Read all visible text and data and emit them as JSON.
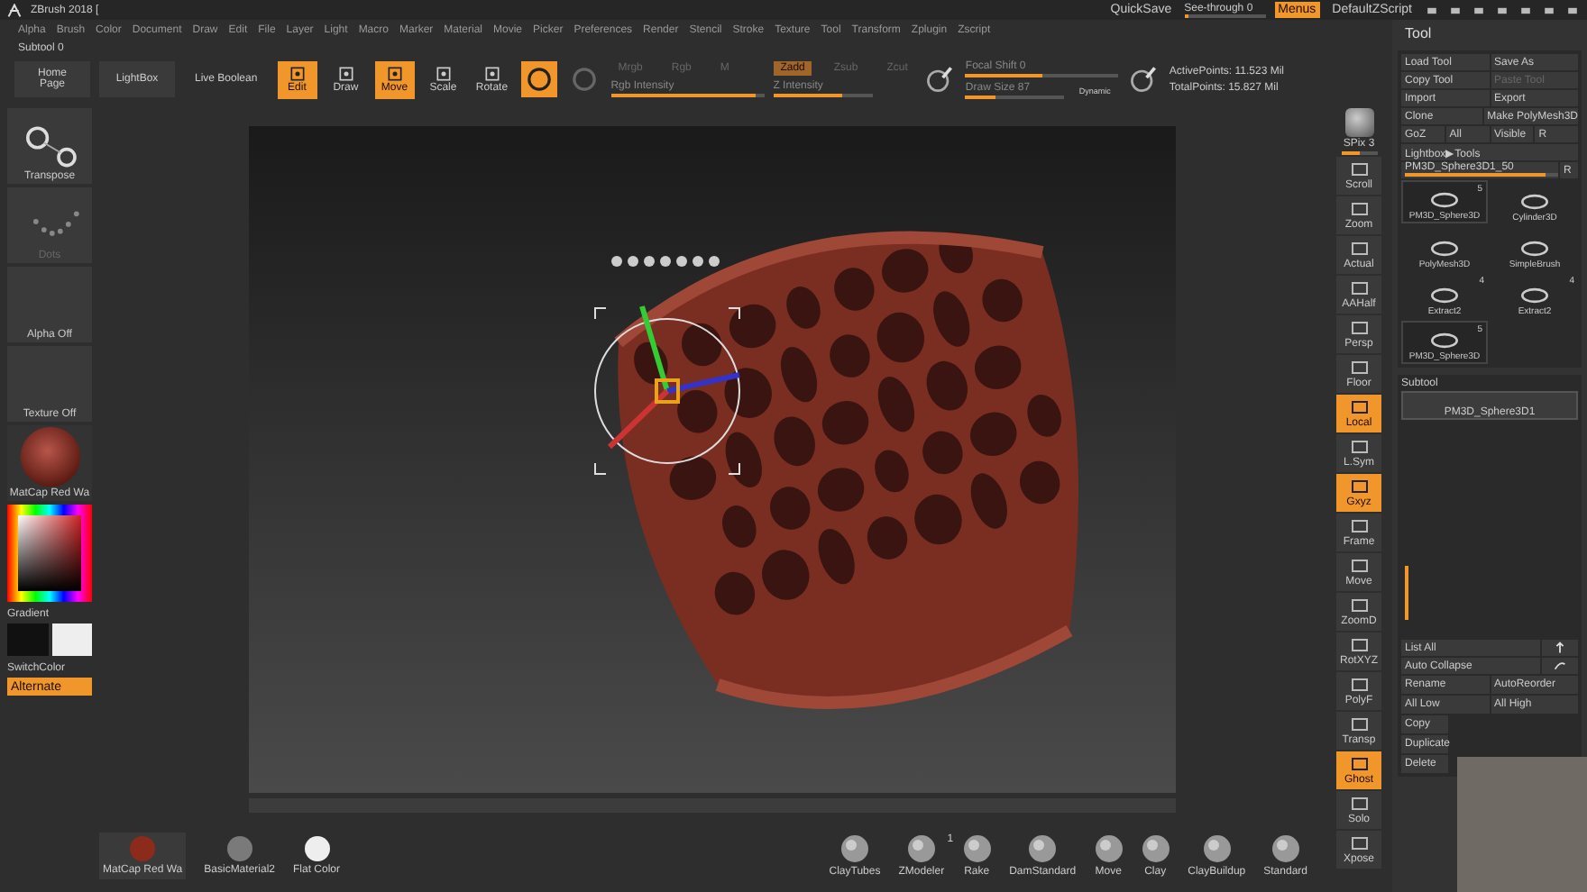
{
  "title_bar": {
    "title": "ZBrush 2018 [",
    "quicksave": "QuickSave",
    "see_through": {
      "label": "See-through 0",
      "level": 0.05
    },
    "menus": {
      "label": "Menus",
      "on": true
    },
    "script": "DefaultZScript"
  },
  "menu_bar": [
    "Alpha",
    "Brush",
    "Color",
    "Document",
    "Draw",
    "Edit",
    "File",
    "Layer",
    "Light",
    "Macro",
    "Marker",
    "Material",
    "Movie",
    "Picker",
    "Preferences",
    "Render",
    "Stencil",
    "Stroke",
    "Texture",
    "Tool",
    "Transform",
    "Zplugin",
    "Zscript"
  ],
  "subtool_label": "Subtool 0",
  "toolbar": {
    "nav_buttons": [
      "Home Page",
      "LightBox",
      "Live Boolean"
    ],
    "modes": [
      {
        "label": "Edit",
        "selected": true
      },
      {
        "label": "Draw",
        "selected": false
      },
      {
        "label": "Move",
        "selected": true
      },
      {
        "label": "Scale",
        "selected": false
      },
      {
        "label": "Rotate",
        "selected": false
      }
    ],
    "toggles": [
      {
        "on": true
      },
      {
        "on": false
      }
    ],
    "color_modes": [
      {
        "label": "Mrgb",
        "selected": false
      },
      {
        "label": "Rgb",
        "selected": false
      },
      {
        "label": "M",
        "selected": false
      }
    ],
    "rgb_intensity": {
      "label": "Rgb Intensity",
      "level": 0.95
    },
    "z_modes": [
      {
        "label": "Zadd",
        "selected": true
      },
      {
        "label": "Zsub",
        "selected": false
      },
      {
        "label": "Zcut",
        "selected": false
      }
    ],
    "z_intensity": {
      "label": "Z Intensity",
      "level": 0.7
    },
    "focal_shift": {
      "label": "Focal Shift 0",
      "level": 0.5
    },
    "draw_size": {
      "label": "Draw Size 87",
      "level": 0.3
    },
    "dynamic": "Dynamic",
    "active_points": "ActivePoints: 11.523 Mil",
    "total_points": "TotalPoints: 15.827 Mil"
  },
  "left_shelf": {
    "transpose": "Transpose",
    "dots": "Dots",
    "alpha": "Alpha Off",
    "texture": "Texture Off",
    "material": "MatCap Red Wa",
    "gradient": "Gradient",
    "switch_color": "SwitchColor",
    "alternate": {
      "label": "Alternate",
      "on": true
    }
  },
  "right_shelf": {
    "spix": {
      "label": "SPix 3",
      "level": 0.5
    },
    "items": [
      {
        "label": "Scroll",
        "on": false
      },
      {
        "label": "Zoom",
        "on": false
      },
      {
        "label": "Actual",
        "on": false
      },
      {
        "label": "AAHalf",
        "on": false
      },
      {
        "label": "Persp",
        "on": false
      },
      {
        "label": "Floor",
        "on": false
      },
      {
        "label": "Local",
        "on": true
      },
      {
        "label": "L.Sym",
        "on": false
      },
      {
        "label": "Gxyz",
        "on": true
      },
      {
        "label": "Frame",
        "on": false
      },
      {
        "label": "Move",
        "on": false
      },
      {
        "label": "ZoomD",
        "on": false
      },
      {
        "label": "RotXYZ",
        "on": false
      },
      {
        "label": "PolyF",
        "on": false
      },
      {
        "label": "Transp",
        "on": false
      },
      {
        "label": "Ghost",
        "on": true
      },
      {
        "label": "Solo",
        "on": false
      },
      {
        "label": "Xpose",
        "on": false
      }
    ]
  },
  "tool_panel": {
    "title": "Tool",
    "button_rows": [
      [
        {
          "label": "Load Tool",
          "disabled": false
        },
        {
          "label": "Save As",
          "disabled": false
        }
      ],
      [
        {
          "label": "Copy Tool",
          "disabled": false
        },
        {
          "label": "Paste Tool",
          "disabled": true
        }
      ],
      [
        {
          "label": "Import",
          "disabled": false
        },
        {
          "label": "Export",
          "disabled": false
        }
      ],
      [
        {
          "label": "Clone",
          "disabled": false
        },
        {
          "label": "Make PolyMesh3D",
          "disabled": false
        }
      ],
      [
        {
          "label": "GoZ",
          "disabled": false
        },
        {
          "label": "All",
          "disabled": false
        },
        {
          "label": "Visible",
          "disabled": false
        },
        {
          "label": "R",
          "disabled": false
        }
      ]
    ],
    "lightbox": "Lightbox▶Tools",
    "current_tool": {
      "label": "PM3D_Sphere3D1_50",
      "level": 0.92,
      "reset": "R"
    },
    "tools": [
      {
        "label": "PM3D_Sphere3D",
        "count": "5",
        "selected": true
      },
      {
        "label": "Cylinder3D",
        "selected": false
      },
      {
        "label": "PolyMesh3D",
        "selected": false
      },
      {
        "label": "SimpleBrush",
        "selected": false
      },
      {
        "label": "Extract2",
        "count": "4",
        "selected": false
      },
      {
        "label": "Extract2",
        "count": "4",
        "selected": false
      },
      {
        "label": "PM3D_Sphere3D",
        "count": "5",
        "selected": true
      }
    ],
    "subtool": {
      "title": "Subtool",
      "items": [
        {
          "label": "PM3D_Sphere3D1",
          "selected": true
        }
      ]
    },
    "list_all": "List All",
    "auto_collapse": "Auto Collapse",
    "actions": [
      [
        "Rename",
        "AutoReorder"
      ],
      [
        "All Low",
        "All High"
      ],
      [
        "Copy"
      ],
      [
        "Duplicate"
      ],
      [
        "Delete"
      ]
    ]
  },
  "bottom_bar": {
    "materials": [
      {
        "label": "MatCap Red Wa",
        "color": "#8c2a1c",
        "selected": true
      },
      {
        "label": "BasicMaterial2",
        "color": "#7a7a7a",
        "selected": false
      },
      {
        "label": "Flat Color",
        "color": "#eeeeee",
        "selected": false
      }
    ],
    "brushes": [
      {
        "label": "ClayTubes"
      },
      {
        "label": "ZModeler",
        "count": "1"
      },
      {
        "label": "Rake"
      },
      {
        "label": "DamStandard"
      },
      {
        "label": "Move"
      },
      {
        "label": "Clay"
      },
      {
        "label": "ClayBuildup"
      },
      {
        "label": "Standard"
      }
    ]
  }
}
